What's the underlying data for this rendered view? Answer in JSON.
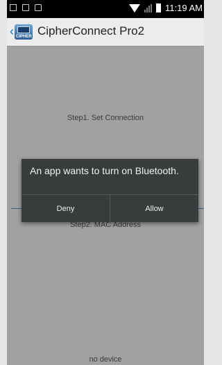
{
  "status_bar": {
    "time": "11:19 AM",
    "icons": [
      "screenshot-icon",
      "image-icon",
      "bag-icon",
      "wifi-icon",
      "signal-icon",
      "battery-icon"
    ]
  },
  "action_bar": {
    "title": "CipherConnect Pro2",
    "app_icon_tag": "CIPHER"
  },
  "main": {
    "step1_label": "Step1. Set Connection",
    "step2_label": "Step2. MAC Address",
    "device_status": "no device"
  },
  "dialog": {
    "message": "An app wants to turn on Bluetooth.",
    "deny_label": "Deny",
    "allow_label": "Allow"
  },
  "colors": {
    "accent_line": "#4c8fcc",
    "dialog_bg": "#373c3d",
    "status_bar_bg": "#000000"
  }
}
